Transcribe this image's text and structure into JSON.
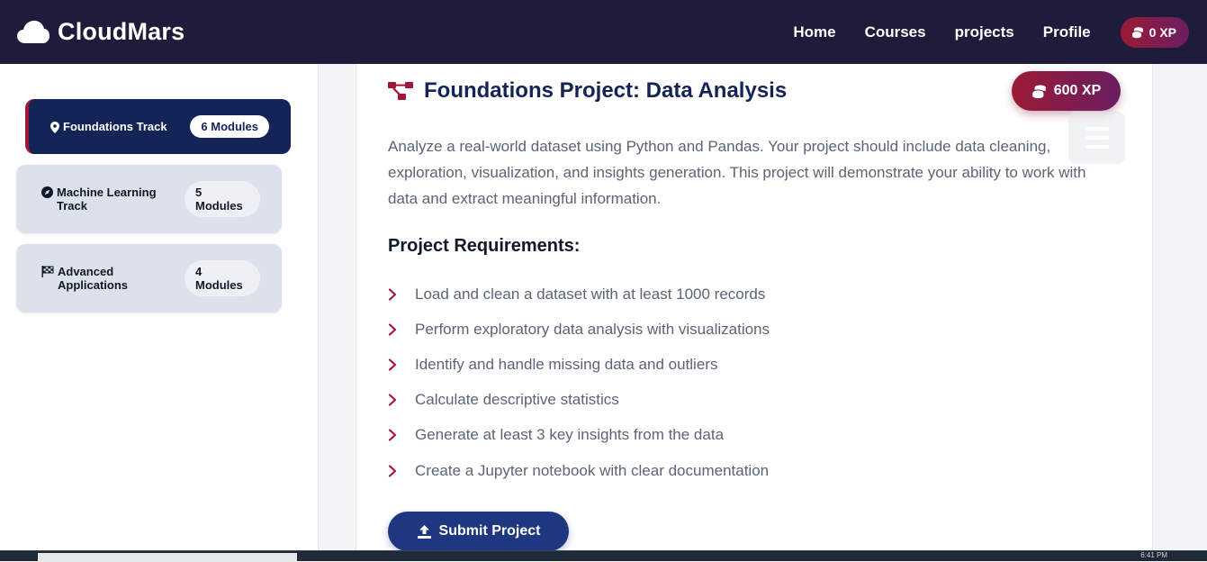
{
  "navbar": {
    "brand": "CloudMars",
    "links": [
      "Home",
      "Courses",
      "projects",
      "Profile"
    ],
    "xp": "0 XP"
  },
  "sidebar": {
    "tracks": [
      {
        "name": "Foundations Track",
        "modules": "6 Modules",
        "icon": "map-pin-icon",
        "active": true
      },
      {
        "name": "Machine Learning Track",
        "modules_count": "5",
        "modules_label": "Modules",
        "icon": "compass-icon",
        "active": false
      },
      {
        "name": "Advanced Applications",
        "modules_count": "4",
        "modules_label": "Modules",
        "icon": "flag-checkered-icon",
        "active": false
      }
    ]
  },
  "project": {
    "icon": "project-diagram-icon",
    "title": "Foundations Project: Data Analysis",
    "xp_reward": "600 XP",
    "description": "Analyze a real-world dataset using Python and Pandas. Your project should include data cleaning, exploration, visualization, and insights generation. This project will demonstrate your ability to work with data and extract meaningful information.",
    "requirements_heading": "Project Requirements:",
    "requirements": [
      "Load and clean a dataset with at least 1000 records",
      "Perform exploratory data analysis with visualizations",
      "Identify and handle missing data and outliers",
      "Calculate descriptive statistics",
      "Generate at least 3 key insights from the data",
      "Create a Jupyter notebook with clear documentation"
    ],
    "submit_label": "Submit Project"
  },
  "taskbar": {
    "clock": "6:41 PM"
  },
  "colors": {
    "navbar_bg": "#1f1b3a",
    "accent_navy": "#152456",
    "accent_crimson": "#9b1b36",
    "submit_blue": "#1f3680"
  }
}
